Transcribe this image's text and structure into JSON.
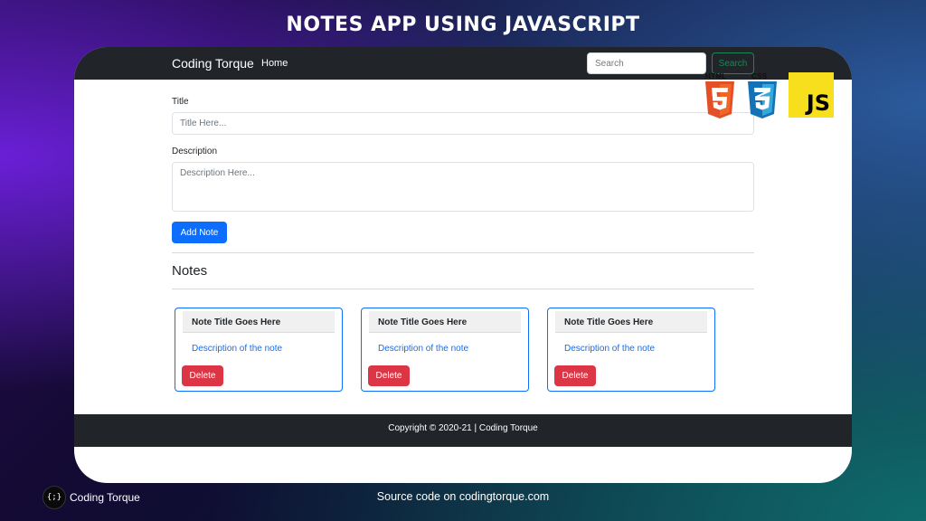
{
  "banner": {
    "title": "NOTES APP USING JAVASCRIPT"
  },
  "navbar": {
    "brand": "Coding Torque",
    "home": "Home",
    "search_placeholder": "Search",
    "search_button": "Search"
  },
  "form": {
    "title_label": "Title",
    "title_placeholder": "Title Here...",
    "description_label": "Description",
    "description_placeholder": "Description Here...",
    "add_button": "Add Note"
  },
  "notes": {
    "heading": "Notes",
    "items": [
      {
        "title": "Note Title Goes Here",
        "description": "Description of the note",
        "delete_label": "Delete"
      },
      {
        "title": "Note Title Goes Here",
        "description": "Description of the note",
        "delete_label": "Delete"
      },
      {
        "title": "Note Title Goes Here",
        "description": "Description of the note",
        "delete_label": "Delete"
      }
    ]
  },
  "footer": {
    "text": "Copyright © 2020-21 | Coding Torque"
  },
  "logos": {
    "html": "HTML",
    "css": "CSS",
    "js": "JS"
  },
  "bottom": {
    "logo_glyph": "{;}",
    "brand": "Coding Torque",
    "source": "Source code on codingtorque.com"
  },
  "colors": {
    "primary": "#0d6efd",
    "danger": "#dc3545",
    "success": "#198754",
    "navbar": "#212529",
    "html5": "#e34f26",
    "css3": "#1572b6",
    "js": "#f7df1e"
  }
}
